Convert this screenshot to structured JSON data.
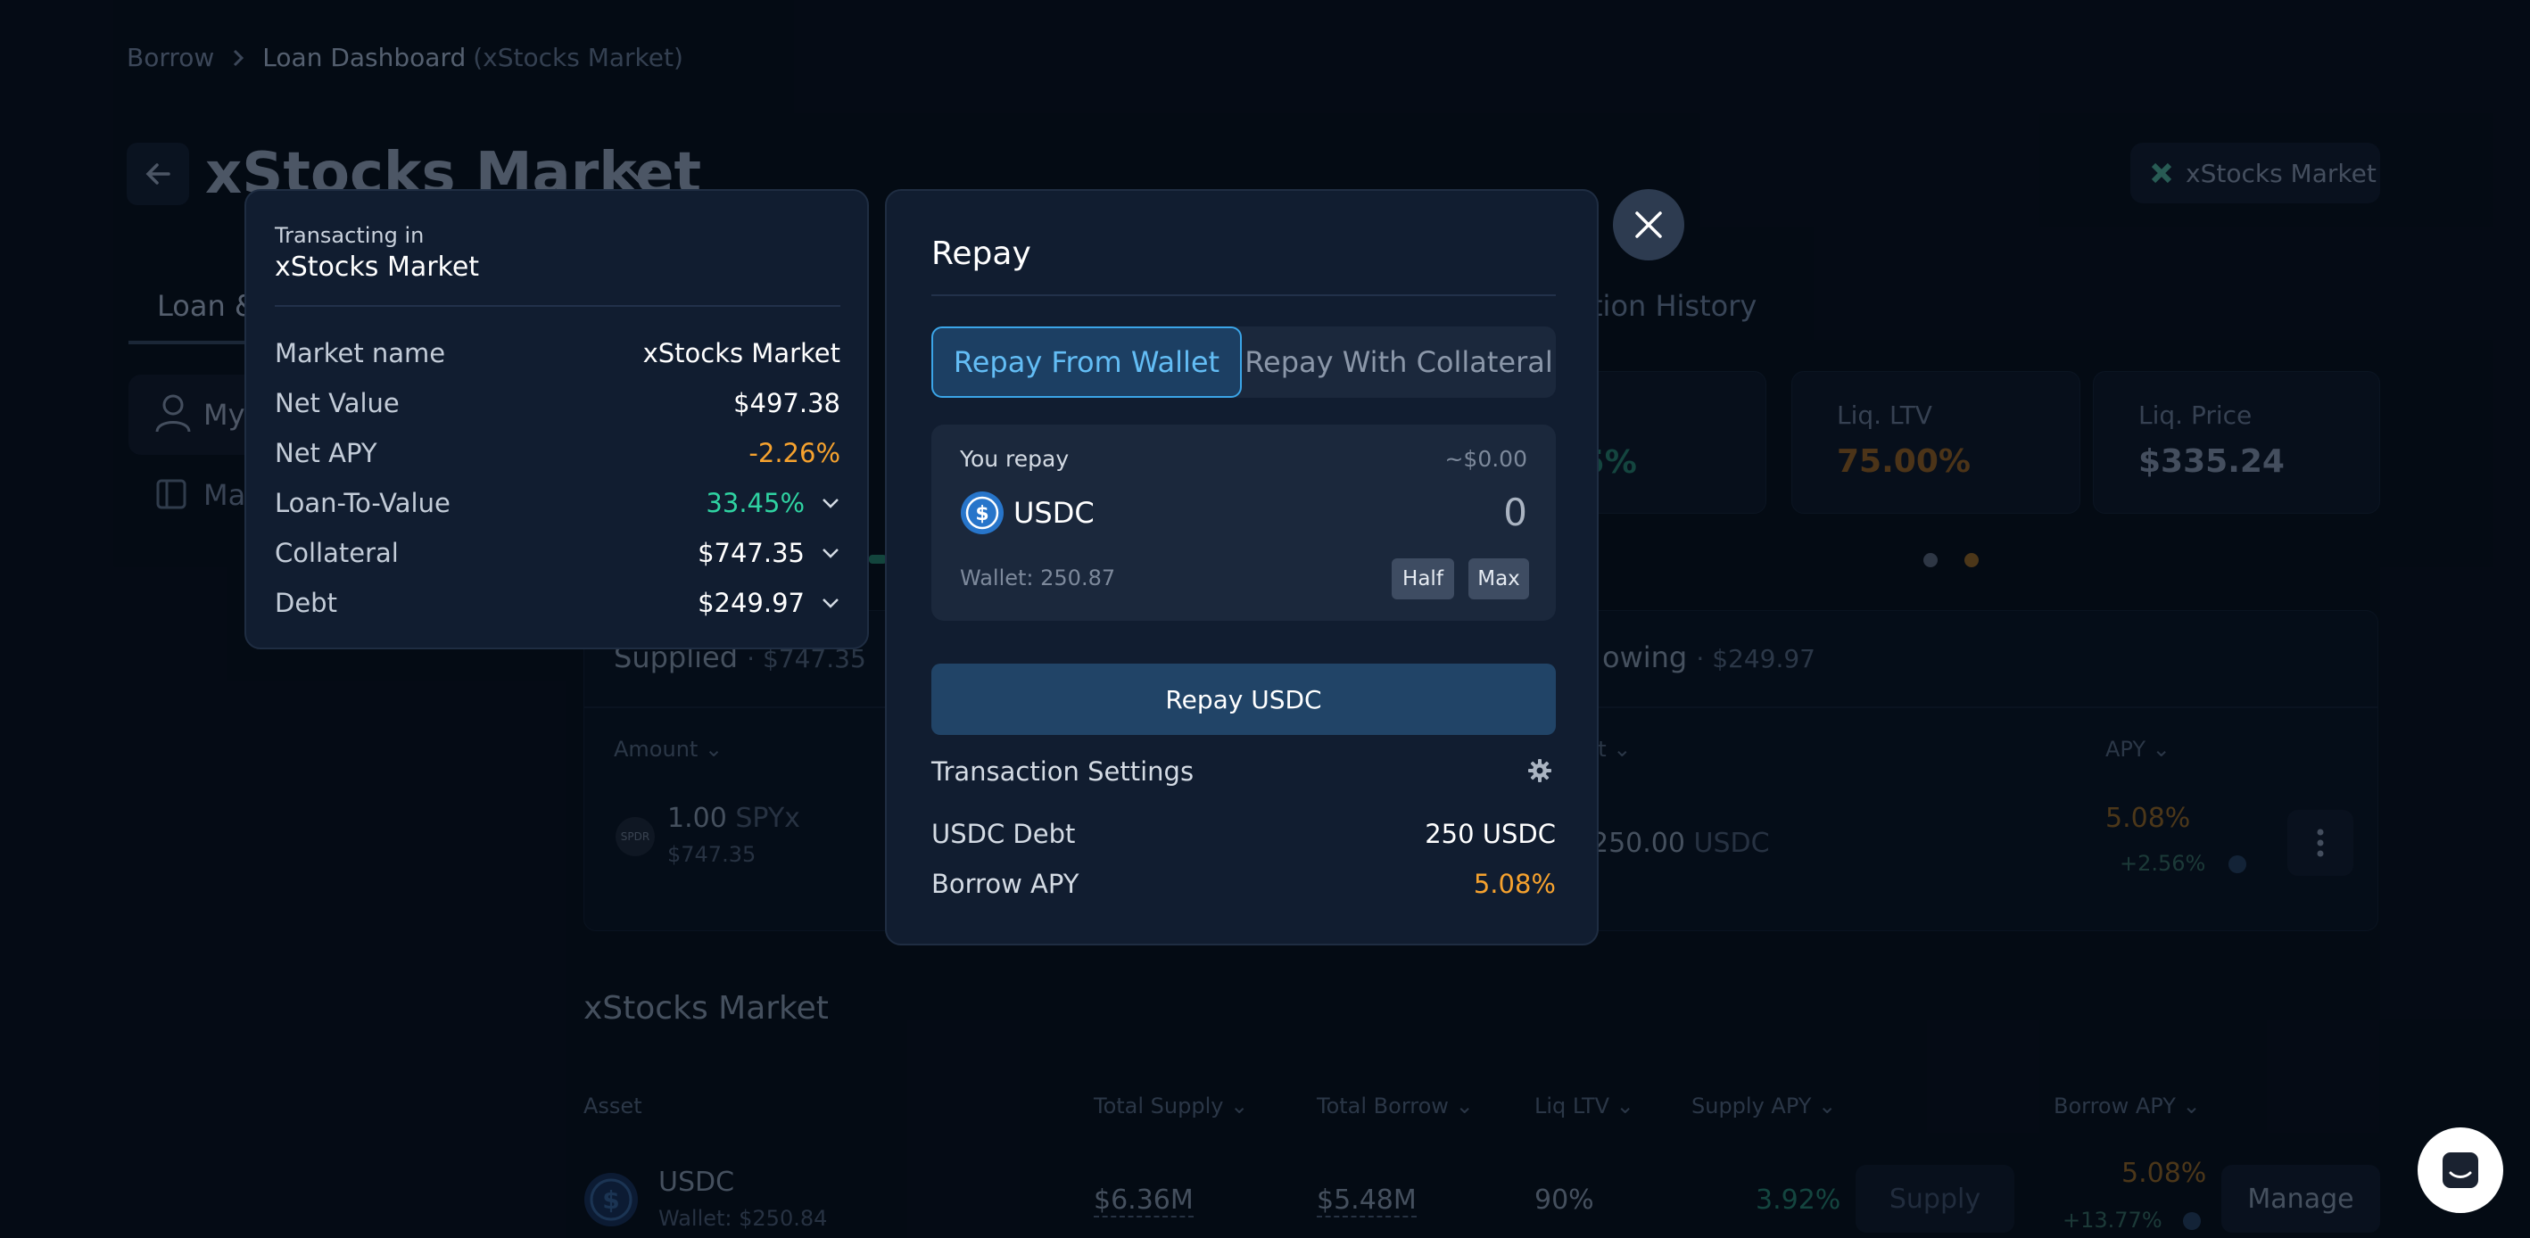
{
  "breadcrumb": {
    "root": "Borrow",
    "current": "Loan Dashboard",
    "context": "(xStocks Market)"
  },
  "page": {
    "title": "xStocks Market",
    "market_chip": "xStocks Market"
  },
  "tabs": {
    "loan": "Loan &",
    "history": "tion History"
  },
  "sidebar": {
    "my_label": "My",
    "ma_label": "Ma"
  },
  "stats": {
    "pct_fragment": ".5%",
    "liq_ltv_label": "Liq. LTV",
    "liq_ltv_value": "75.00%",
    "liq_price_label": "Liq. Price",
    "liq_price_value": "$335.24"
  },
  "supplied": {
    "title": "Supplied",
    "total": "· $747.35",
    "col_amount": "Amount",
    "amount": "1.00",
    "token": "SPYx",
    "usd": "$747.35",
    "badge": "SPDR"
  },
  "borrowing": {
    "title": "owing",
    "total": "· $249.97",
    "col_amount": "nt",
    "col_apy": "APY",
    "amount": "250.00",
    "token": "USDC",
    "apy": "5.08%",
    "apy_reward": "+2.56%"
  },
  "market": {
    "title": "xStocks Market",
    "headers": {
      "asset": "Asset",
      "total_supply": "Total Supply",
      "total_borrow": "Total Borrow",
      "liq_ltv": "Liq LTV",
      "supply_apy": "Supply APY",
      "borrow_apy": "Borrow APY"
    },
    "row": {
      "name": "USDC",
      "wallet": "Wallet: $250.84",
      "total_supply": "$6.36M",
      "total_borrow": "$5.48M",
      "liq_ltv": "90%",
      "supply_apy": "3.92%",
      "supply_btn": "Supply",
      "borrow_apy": "5.08%",
      "borrow_reward": "+13.77%",
      "manage_btn": "Manage"
    }
  },
  "info_card": {
    "transacting_label": "Transacting in",
    "market": "xStocks Market",
    "rows": [
      {
        "key": "Market name",
        "value": "xStocks Market"
      },
      {
        "key": "Net Value",
        "value": "$497.38"
      },
      {
        "key": "Net APY",
        "value": "-2.26%"
      },
      {
        "key": "Loan-To-Value",
        "value": "33.45%"
      },
      {
        "key": "Collateral",
        "value": "$747.35"
      },
      {
        "key": "Debt",
        "value": "$249.97"
      }
    ]
  },
  "modal": {
    "title": "Repay",
    "tab_wallet": "Repay From Wallet",
    "tab_collateral": "Repay With Collateral",
    "you_repay": "You repay",
    "usd_value": "~$0.00",
    "token": "USDC",
    "amount": "0",
    "wallet": "Wallet: 250.87",
    "half": "Half",
    "max": "Max",
    "submit": "Repay USDC",
    "tx_settings": "Transaction Settings",
    "debt_label": "USDC Debt",
    "debt_value": "250 USDC",
    "apy_label": "Borrow APY",
    "apy_value": "5.08%"
  },
  "colors": {
    "accent_blue": "#3ba5e8",
    "positive_green": "#2fd3a2",
    "warning_orange": "#f6a22e",
    "modal_bg": "#111d30"
  }
}
